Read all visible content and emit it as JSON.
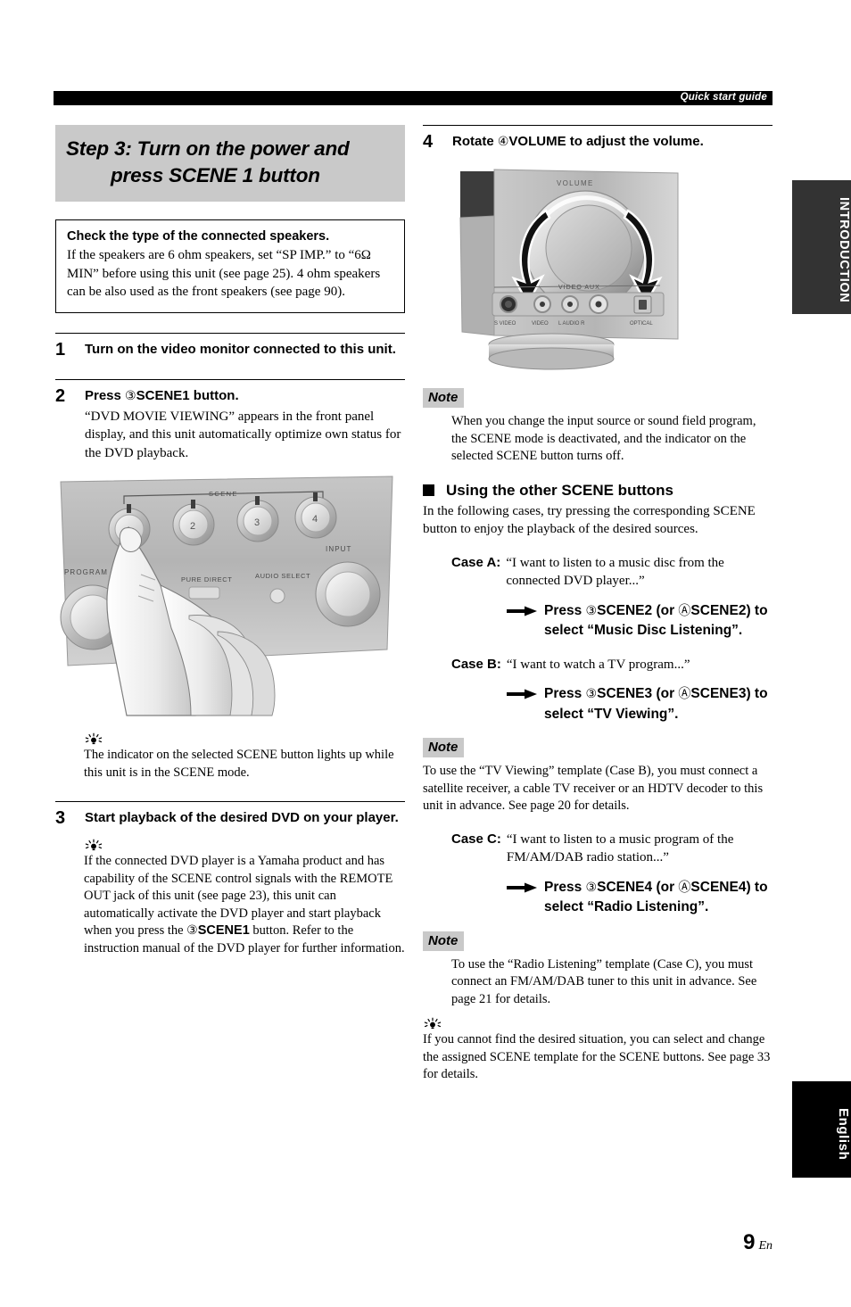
{
  "header": {
    "running_head": "Quick start guide",
    "section_tab": "INTRODUCTION",
    "language_tab": "English"
  },
  "page_number": {
    "number": "9",
    "suffix": "En"
  },
  "left_column": {
    "step_title": {
      "line1": "Step 3: Turn on the power and",
      "line2": "press SCENE 1 button"
    },
    "callout": {
      "title": "Check the type of the connected speakers.",
      "body": "If the speakers are 6 ohm speakers, set “SP IMP.” to “6Ω MIN” before using this unit (see page 25). 4 ohm speakers can be also used as the front speakers (see page 90)."
    },
    "steps": [
      {
        "num": "1",
        "head": "Turn on the video monitor connected to this unit.",
        "sub": ""
      },
      {
        "num": "2",
        "head_pre": "Press ",
        "head_circ": "③",
        "head_bold": "SCENE1",
        "head_post": " button.",
        "sub": "“DVD MOVIE VIEWING” appears in the front panel display, and this unit automatically optimize own status for the DVD playback."
      },
      {
        "num": "3",
        "head": "Start playback of the desired DVD on your player.",
        "sub": ""
      }
    ],
    "tip_after_step2": "The indicator on the selected SCENE button lights up while this unit is in the SCENE mode.",
    "tip_after_step3": {
      "part1": "If the connected DVD player is a Yamaha product and has capability of the SCENE control signals with the REMOTE OUT jack of this unit (see page 23), this unit can automatically activate the DVD player and start playback when you press the ",
      "circ": "③",
      "bold": "SCENE1",
      "part2": " button. Refer to the instruction manual of the DVD player for further information."
    },
    "front_panel_illustration": {
      "scene_group_label": "SCENE",
      "scene_buttons": [
        "1",
        "2",
        "3",
        "4"
      ],
      "program_label": "PROGRAM",
      "pure_direct_label": "PURE DIRECT",
      "audio_select_label": "AUDIO SELECT",
      "input_label": "INPUT"
    }
  },
  "right_column": {
    "step4": {
      "num": "4",
      "head_pre": "Rotate ",
      "head_circ": "④",
      "head_bold": "VOLUME",
      "head_post": " to adjust the volume."
    },
    "volume_illustration": {
      "volume_label": "VOLUME",
      "video_aux_label": "VIDEO AUX",
      "jack_labels": [
        "S VIDEO",
        "VIDEO",
        "L  AUDIO  R",
        "OPTICAL"
      ]
    },
    "note1": {
      "label": "Note",
      "body": "When you change the input source or sound field program, the SCENE mode is deactivated, and the indicator on the selected SCENE button turns off."
    },
    "section": {
      "heading": "Using the other SCENE buttons",
      "intro": "In the following cases, try pressing the corresponding SCENE button to enjoy the playback of the desired sources."
    },
    "cases": [
      {
        "label": "Case A:",
        "text": "“I want to listen to a music disc from the connected DVD player...”",
        "action_pre": "Press ",
        "action_circ1": "③",
        "action_b1": "SCENE2",
        "action_mid": " (or ",
        "action_circ2": "Ⓐ",
        "action_b2": "SCENE2",
        "action_post": ") to select “Music Disc Listening”."
      },
      {
        "label": "Case B:",
        "text": "“I want to watch a TV program...”",
        "action_pre": "Press ",
        "action_circ1": "③",
        "action_b1": "SCENE3",
        "action_mid": " (or ",
        "action_circ2": "Ⓐ",
        "action_b2": "SCENE3",
        "action_post": ") to select “TV Viewing”."
      },
      {
        "label": "Case C:",
        "text": "“I want to listen to a music program of the FM/AM/DAB radio station...”",
        "action_pre": "Press ",
        "action_circ1": "③",
        "action_b1": "SCENE4",
        "action_mid": " (or ",
        "action_circ2": "Ⓐ",
        "action_b2": "SCENE4",
        "action_post": ") to select “Radio Listening”."
      }
    ],
    "note2": {
      "label": "Note",
      "body": "To use the “TV Viewing” template (Case B), you must connect a satellite receiver, a cable TV receiver or an HDTV decoder to this unit in advance. See page 20 for details."
    },
    "note3": {
      "label": "Note",
      "body": "To use the “Radio Listening” template (Case C), you must connect an FM/AM/DAB tuner to this unit in advance. See page 21 for details."
    },
    "tip_final": "If you cannot find the desired situation, you can select and change the assigned SCENE template for the SCENE buttons. See page 33 for details."
  }
}
